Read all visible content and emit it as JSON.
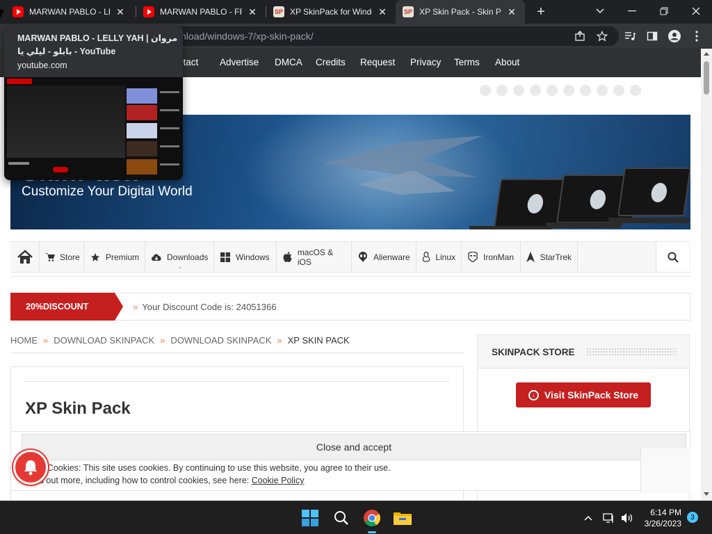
{
  "browser": {
    "tabs": [
      {
        "label": "MARWAN PABLO - LELL",
        "favicon": "youtube-icon",
        "active": false
      },
      {
        "label": "MARWAN PABLO - FRE",
        "favicon": "youtube-icon",
        "active": false
      },
      {
        "label": "XP SkinPack for Windo",
        "favicon": "skinpack-icon",
        "active": false
      },
      {
        "label": "XP Skin Pack - Skin Pac",
        "favicon": "skinpack-icon",
        "active": true
      }
    ],
    "url": "nload/windows-7/xp-skin-pack/",
    "hover_card": {
      "title": "MARWAN PABLO - LELLY YAH | مروان بابلو - ليلي يا - YouTube",
      "domain": "youtube.com"
    },
    "accent": "#35363a"
  },
  "site": {
    "top_nav": [
      "ntact",
      "Advertise",
      "DMCA",
      "Credits",
      "Request",
      "Privacy",
      "Terms",
      "About"
    ],
    "banner": {
      "tagline": "Customize Your Digital World",
      "brand": "SkinPack"
    },
    "category_nav": [
      {
        "label": "Store",
        "icon": "cart-icon"
      },
      {
        "label": "Premium",
        "icon": "star-icon"
      },
      {
        "label": "Downloads",
        "icon": "cloud-download-icon"
      },
      {
        "label": "Windows",
        "icon": "windows-icon"
      },
      {
        "label": "macOS & iOS",
        "icon": "apple-icon"
      },
      {
        "label": "Alienware",
        "icon": "alien-icon"
      },
      {
        "label": "Linux",
        "icon": "linux-icon"
      },
      {
        "label": "IronMan",
        "icon": "ironman-icon"
      },
      {
        "label": "StarTrek",
        "icon": "startrek-icon"
      }
    ],
    "discount": {
      "badge": "20%DISCOUNT",
      "text": "Your Discount Code is: 24051366"
    },
    "breadcrumb": [
      "HOME",
      "DOWNLOAD SKINPACK",
      "DOWNLOAD SKINPACK",
      "XP SKIN PACK"
    ],
    "article_title": "XP Skin Pack",
    "sidebar": {
      "title": "SKINPACK STORE",
      "button": "Visit SkinPack Store"
    },
    "cookie": {
      "accept": "Close and accept",
      "line1": "& Cookies: This site uses cookies. By continuing to use this website, you agree to their use.",
      "line2_prefix": "d out more, including how to control cookies, see here: ",
      "link": "Cookie Policy"
    },
    "brand_color": "#c61f1f"
  },
  "taskbar": {
    "time": "6:14 PM",
    "date": "3/26/2023",
    "notifications": "3"
  }
}
